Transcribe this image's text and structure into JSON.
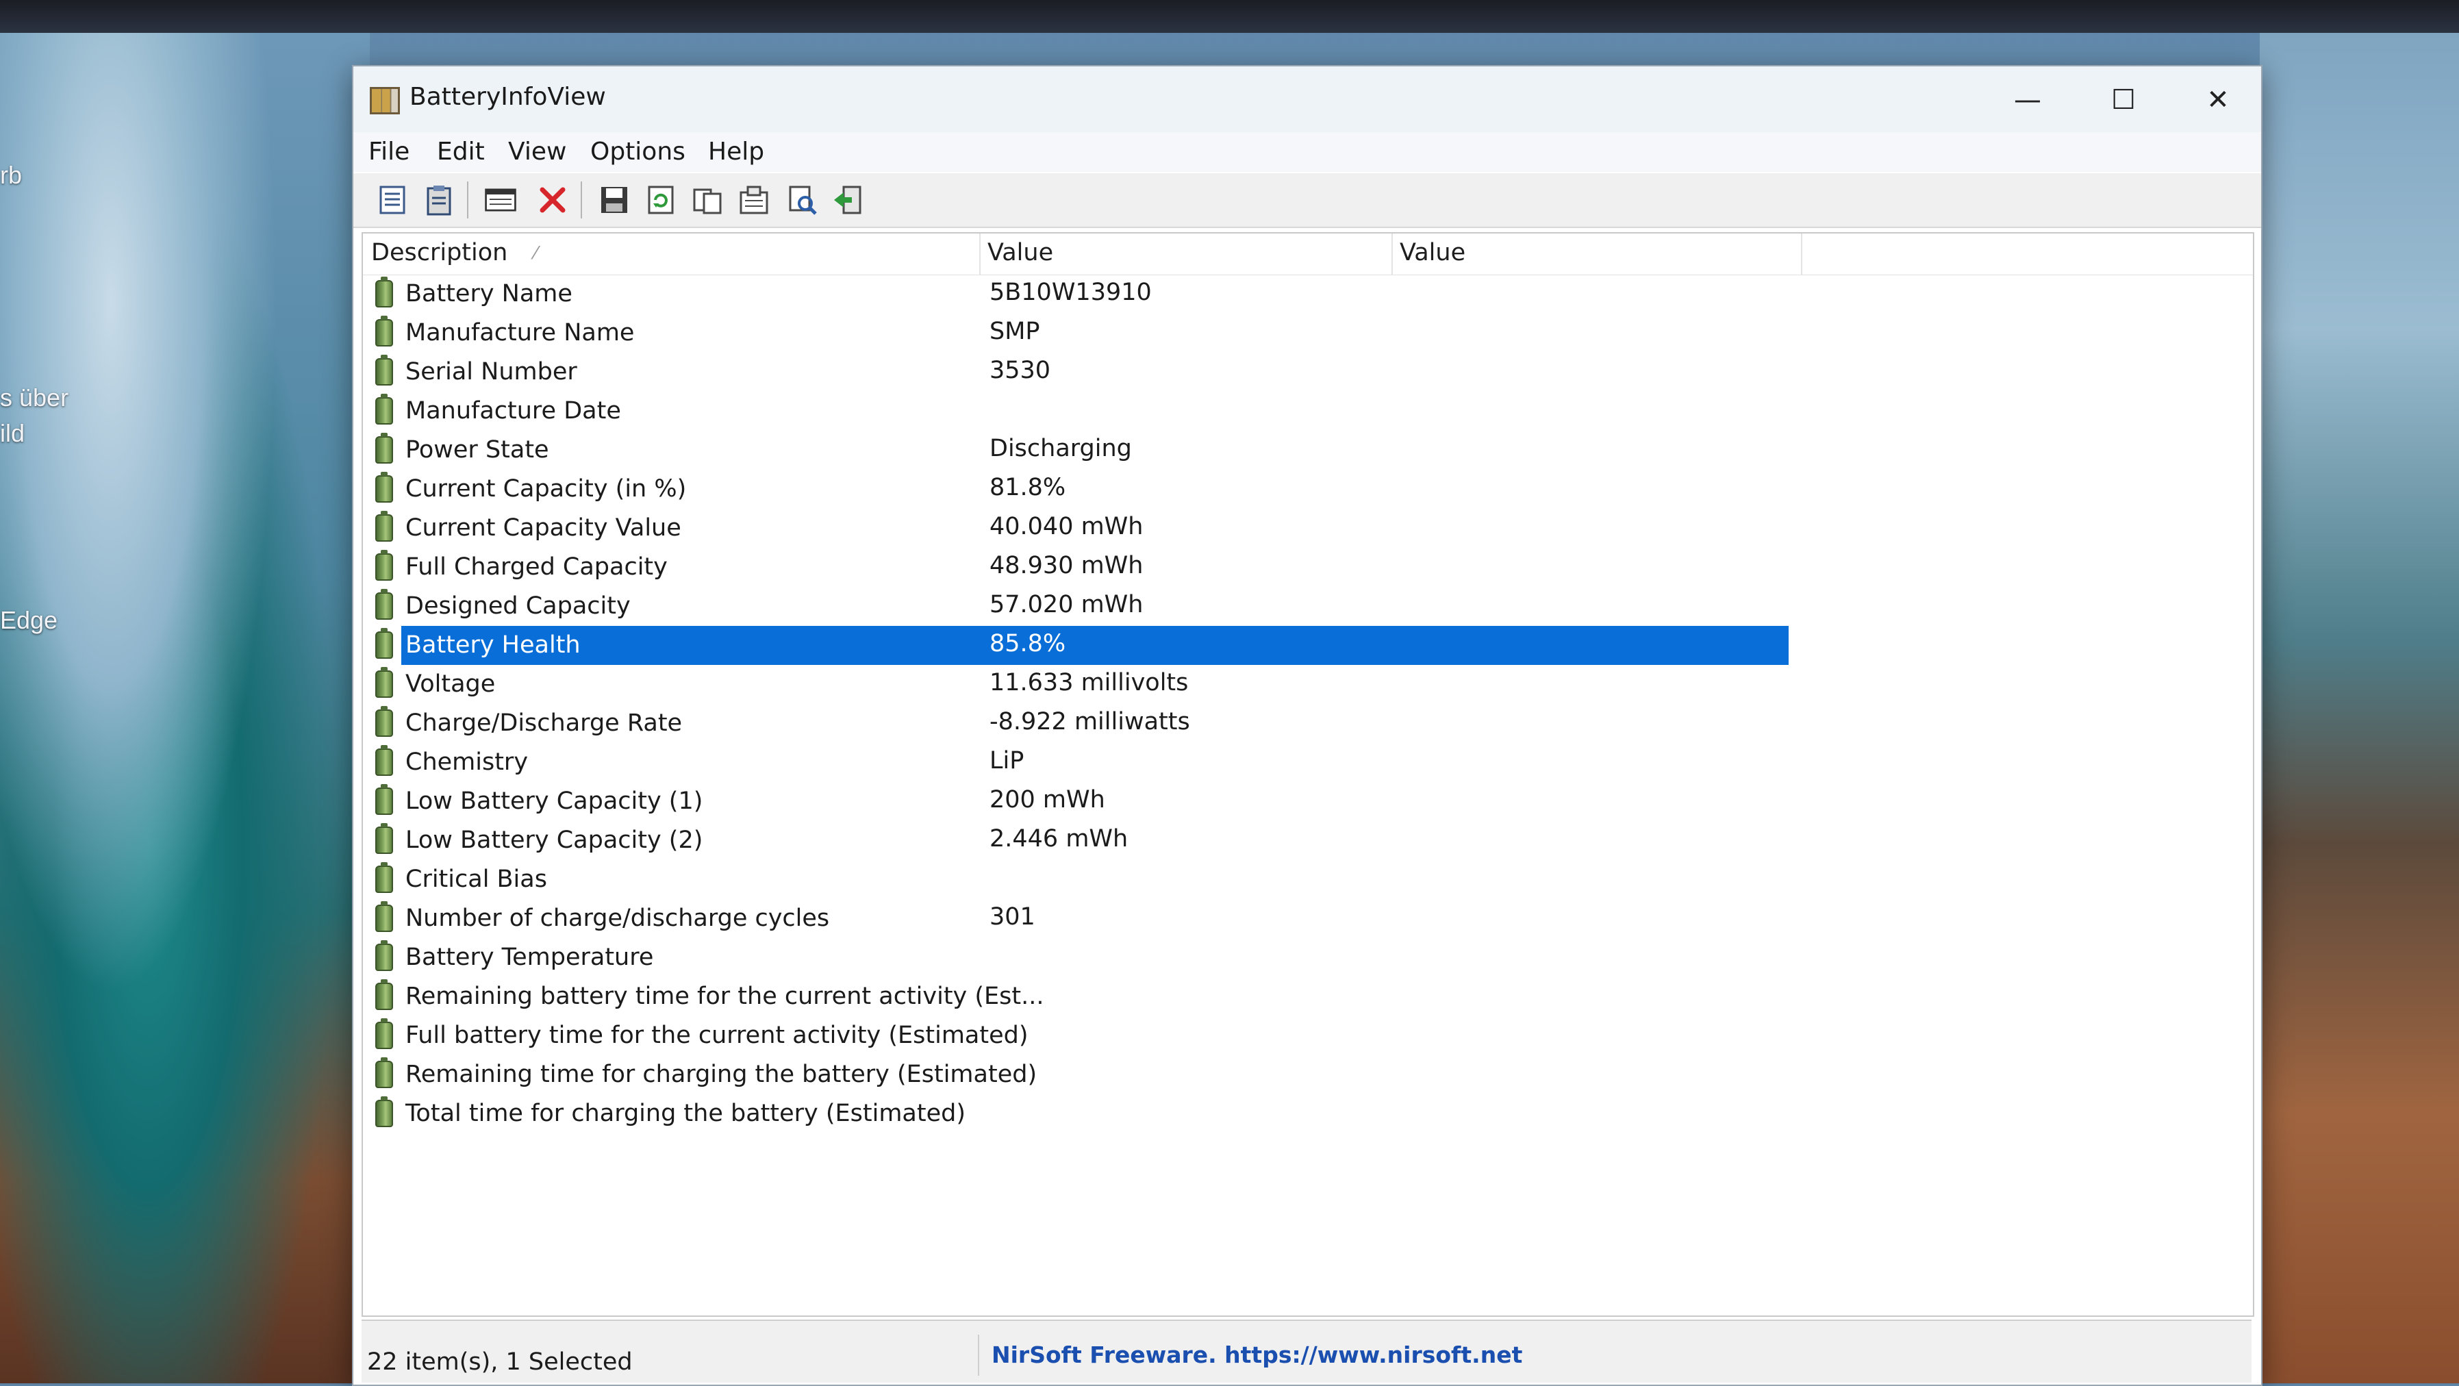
{
  "desktop": {
    "snippets": [
      "rb",
      "s über",
      "ild",
      "Edge"
    ]
  },
  "window": {
    "title": "BatteryInfoView",
    "controls": {
      "minimize": "—",
      "maximize": "☐",
      "close": "✕"
    }
  },
  "menu": {
    "items": [
      "File",
      "Edit",
      "View",
      "Options",
      "Help"
    ]
  },
  "toolbar": {
    "icons": [
      "properties-icon",
      "clipboard-icon",
      "window-icon",
      "delete-icon",
      "save-icon",
      "refresh-icon",
      "copy-icon",
      "html-report-icon",
      "find-icon",
      "exit-icon"
    ]
  },
  "columns": [
    "Description",
    "Value",
    "Value"
  ],
  "rows": [
    {
      "description": "Battery Name",
      "value": "5B10W13910"
    },
    {
      "description": "Manufacture Name",
      "value": "SMP"
    },
    {
      "description": "Serial Number",
      "value": " 3530"
    },
    {
      "description": "Manufacture Date",
      "value": ""
    },
    {
      "description": "Power State",
      "value": "Discharging"
    },
    {
      "description": "Current Capacity (in %)",
      "value": "81.8%"
    },
    {
      "description": "Current Capacity Value",
      "value": "40.040 mWh"
    },
    {
      "description": "Full Charged Capacity",
      "value": "48.930 mWh"
    },
    {
      "description": "Designed Capacity",
      "value": "57.020 mWh"
    },
    {
      "description": "Battery Health",
      "value": "85.8%",
      "selected": true
    },
    {
      "description": "Voltage",
      "value": "11.633 millivolts"
    },
    {
      "description": "Charge/Discharge Rate",
      "value": "-8.922 milliwatts"
    },
    {
      "description": "Chemistry",
      "value": "LiP"
    },
    {
      "description": "Low Battery Capacity (1)",
      "value": "200 mWh"
    },
    {
      "description": "Low Battery Capacity (2)",
      "value": "2.446 mWh"
    },
    {
      "description": "Critical Bias",
      "value": ""
    },
    {
      "description": "Number of charge/discharge cycles",
      "value": "301"
    },
    {
      "description": "Battery Temperature",
      "value": ""
    },
    {
      "description": "Remaining battery time for the current activity (Est...",
      "value": ""
    },
    {
      "description": "Full battery time for the current activity (Estimated)",
      "value": ""
    },
    {
      "description": "Remaining time for charging the battery (Estimated)",
      "value": ""
    },
    {
      "description": "Total  time for charging the battery (Estimated)",
      "value": ""
    }
  ],
  "status": {
    "items": "22 item(s), 1 Selected",
    "link": "NirSoft Freeware. https://www.nirsoft.net"
  },
  "colors": {
    "selection": "#0a6ed8",
    "link": "#1a4fb0"
  }
}
